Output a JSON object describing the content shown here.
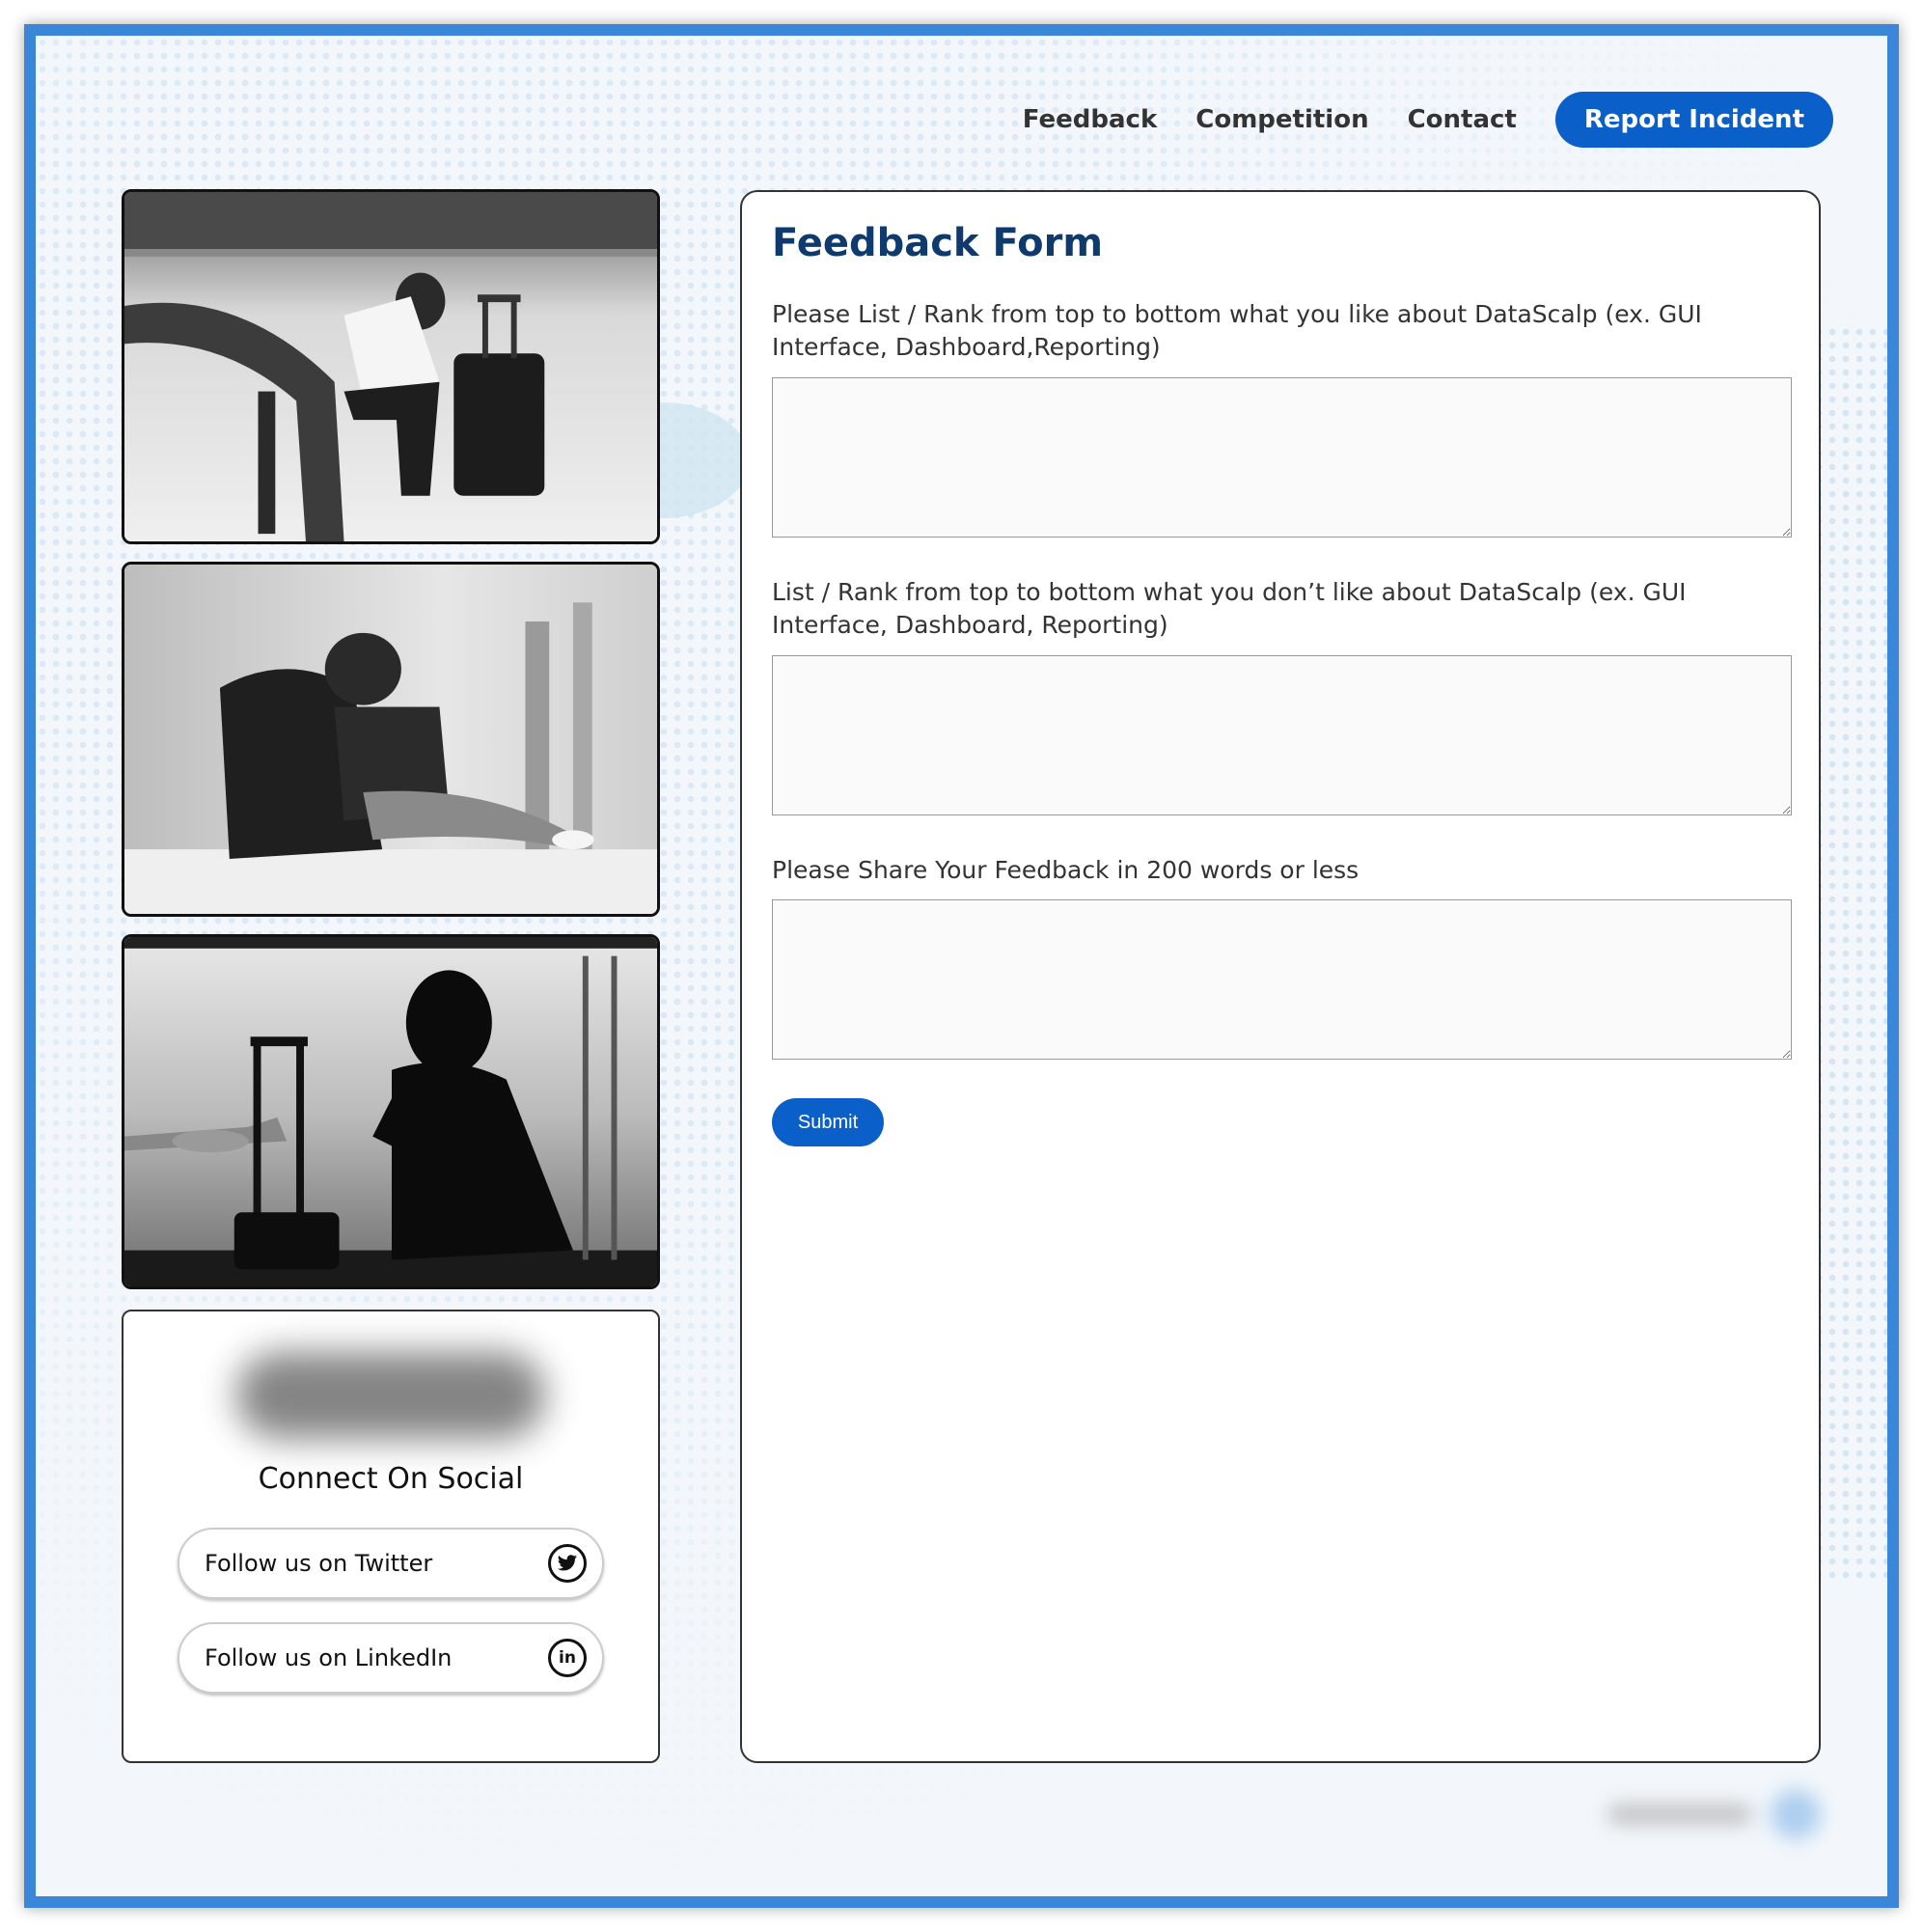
{
  "nav": {
    "items": [
      "Feedback",
      "Competition",
      "Contact"
    ],
    "cta": "Report Incident"
  },
  "social": {
    "title": "Connect On Social",
    "twitter_label": "Follow us on Twitter",
    "linkedin_label": "Follow us on LinkedIn",
    "twitter_icon": "twitter-icon",
    "linkedin_icon": "linkedin-icon"
  },
  "form": {
    "title": "Feedback Form",
    "q1": "Please List / Rank from top to bottom what you like about DataScalp (ex. GUI Interface, Dashboard,Reporting)",
    "q2": "List / Rank from top to bottom what you don’t like about DataScalp (ex. GUI Interface, Dashboard, Reporting)",
    "q3": "Please Share Your Feedback in 200 words or less",
    "submit": "Submit"
  },
  "colors": {
    "accent": "#0a5fc8",
    "frame": "#3a86d8",
    "heading": "#0e3a6e"
  }
}
